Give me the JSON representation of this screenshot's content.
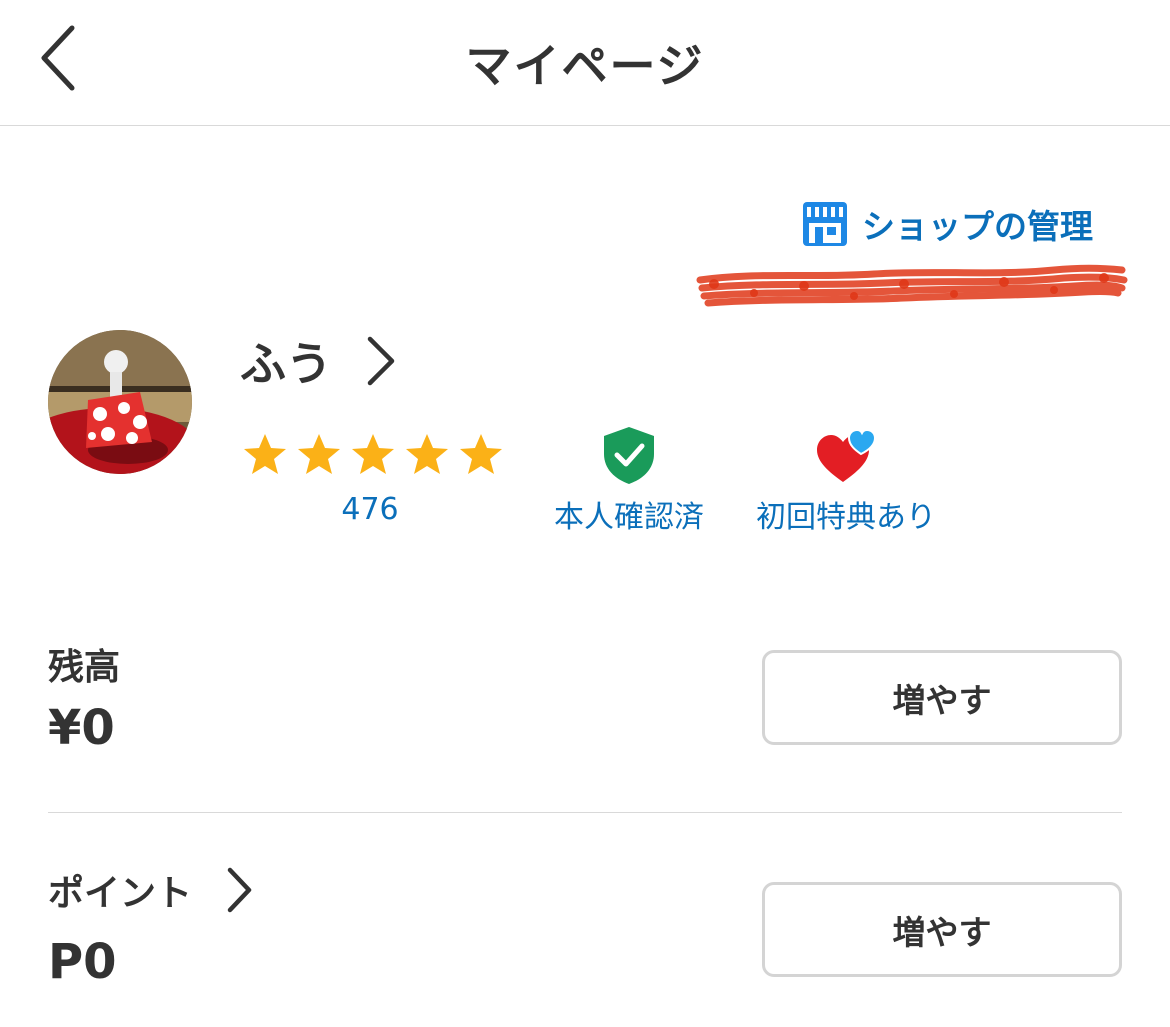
{
  "header": {
    "title": "マイページ",
    "back_icon": "chevron-left-icon"
  },
  "shop": {
    "label": "ショップの管理",
    "icon": "storefront-icon",
    "icon_color": "#1e88e5"
  },
  "profile": {
    "name": "ふう",
    "rating_stars": 5,
    "rating_max": 5,
    "rating_count": "476",
    "star_color": "#fbb117"
  },
  "badges": {
    "verified": {
      "label": "本人確認済",
      "icon": "shield-check-icon",
      "color": "#1a9b5a"
    },
    "first_time": {
      "label": "初回特典あり",
      "icon": "hearts-icon",
      "color": "#e31e24"
    }
  },
  "balance": {
    "label": "残高",
    "value": "¥0",
    "button_label": "増やす"
  },
  "points": {
    "label": "ポイント",
    "value": "P0",
    "button_label": "増やす"
  },
  "colors": {
    "accent_blue": "#0b6fba",
    "text": "#333333",
    "redaction": "#e03818"
  }
}
